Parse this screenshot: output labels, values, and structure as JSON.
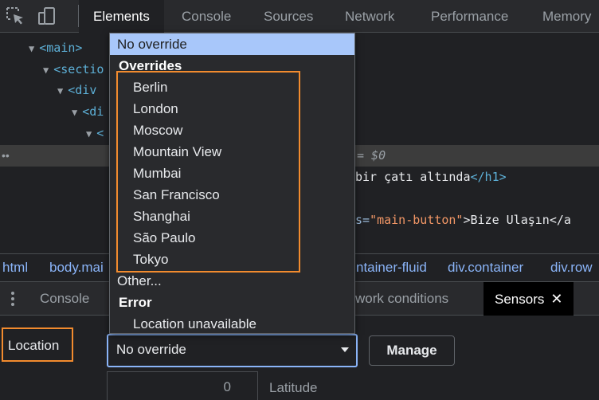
{
  "toolbar": {
    "icons": [
      "inspect-element-icon",
      "device-toolbar-icon"
    ],
    "tabs": [
      "Elements",
      "Console",
      "Sources",
      "Network",
      "Performance",
      "Memory"
    ],
    "active_tab": "Elements"
  },
  "dom": {
    "main_tag": "<main>",
    "section_tag": "<sectio",
    "div1_tag": "<div",
    "div2_tag": "<di",
    "div3_tag": "<",
    "selected_suffix": "= $0",
    "h1_text": "bir çatı altında",
    "h1_close": "</h1>",
    "button_attr_tail": "s=",
    "button_attr_value": "\"main-button\"",
    "button_text": ">Bize Ulaşın</a"
  },
  "breadcrumbs": [
    "html",
    "body.mai",
    "ntainer-fluid",
    "div.container",
    "div.row"
  ],
  "drawer": {
    "tabs": [
      "Console",
      "work conditions",
      "Sensors"
    ],
    "active_tab": "Sensors",
    "close_symbol": "✕"
  },
  "sensors": {
    "location_label": "Location",
    "select_value": "No override",
    "manage_label": "Manage",
    "latitude_value": "0",
    "latitude_label": "Latitude"
  },
  "dropdown": {
    "selected": "No override",
    "group_overrides": "Overrides",
    "cities": [
      "Berlin",
      "London",
      "Moscow",
      "Mountain View",
      "Mumbai",
      "San Francisco",
      "Shanghai",
      "São Paulo",
      "Tokyo"
    ],
    "other": "Other...",
    "group_error": "Error",
    "error_item": "Location unavailable"
  },
  "colors": {
    "highlight": "#f28b2e",
    "selected_option": "#a8c7fa",
    "tag": "#5db0d7",
    "attr_value": "#f29766",
    "link": "#8ab4f8"
  }
}
